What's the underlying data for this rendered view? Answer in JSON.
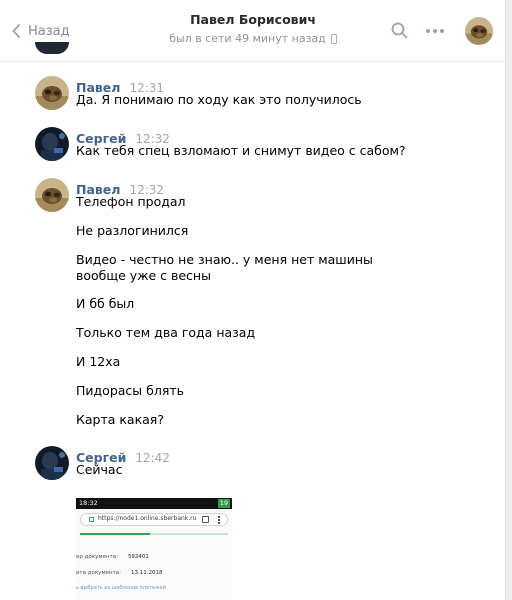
{
  "header": {
    "back_label": "Назад",
    "peer_name": "Павел Борисович",
    "peer_status": "был в сети 49 минут назад"
  },
  "icons": {
    "back": "chevron-left-icon",
    "search": "search-icon",
    "more": "more-horizontal-icon",
    "mobile": "mobile-phone-icon"
  },
  "colors": {
    "author_name": "#42648b",
    "secondary_text": "#828a99",
    "time": "#a0a6ae"
  },
  "messages": [
    {
      "author": "Павел",
      "time": "12:31",
      "lines": [
        "Да. Я понимаю по ходу как это получилось"
      ]
    },
    {
      "author": "Сергей",
      "time": "12:32",
      "lines": [
        "Как тебя спец взломают и снимут видео с сабом?"
      ]
    },
    {
      "author": "Павел",
      "time": "12:32",
      "lines": [
        "Телефон продал",
        "Не разлогинился",
        "Видео - честно не знаю.. у меня нет машины вообще уже с весны",
        "И бб был",
        "Только тем два года назад",
        "И 12ха",
        "Пидорасы блять",
        "Карта какая?"
      ]
    },
    {
      "author": "Сергей",
      "time": "12:42",
      "lines": [
        "Сейчас"
      ]
    }
  ],
  "attachment": {
    "status_time": "18:32",
    "battery": "19",
    "url": "https://node1.online.sberbank.ru",
    "row1_label": "ер документа:",
    "row1_value": "592401",
    "row2_label": "ата документа:",
    "row2_value": "13.11.2018",
    "link_text": "ь выбрать из шаблонов платежей"
  }
}
